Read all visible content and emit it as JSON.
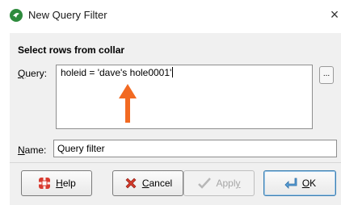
{
  "window": {
    "title": "New Query Filter",
    "close_glyph": "×"
  },
  "section_title": "Select rows from collar",
  "query": {
    "label_mnemonic": "Q",
    "label_rest": "uery:",
    "value": "holeid = 'dave's hole0001'",
    "ellipsis_label": "..."
  },
  "name": {
    "label_mnemonic": "N",
    "label_rest": "ame:",
    "value": "Query filter"
  },
  "buttons": {
    "help": {
      "mnemonic": "H",
      "rest": "elp",
      "icon": "lifebuoy-icon"
    },
    "cancel": {
      "mnemonic": "C",
      "rest": "ancel",
      "icon": "red-x-icon"
    },
    "apply": {
      "before": "Appl",
      "mnemonic": "y",
      "icon": "checkmark-icon",
      "enabled": false
    },
    "ok": {
      "mnemonic": "O",
      "rest": "K",
      "icon": "enter-arrow-icon"
    }
  },
  "colors": {
    "annotation_arrow": "#f26a22",
    "app_icon": "#2e8b3d"
  }
}
